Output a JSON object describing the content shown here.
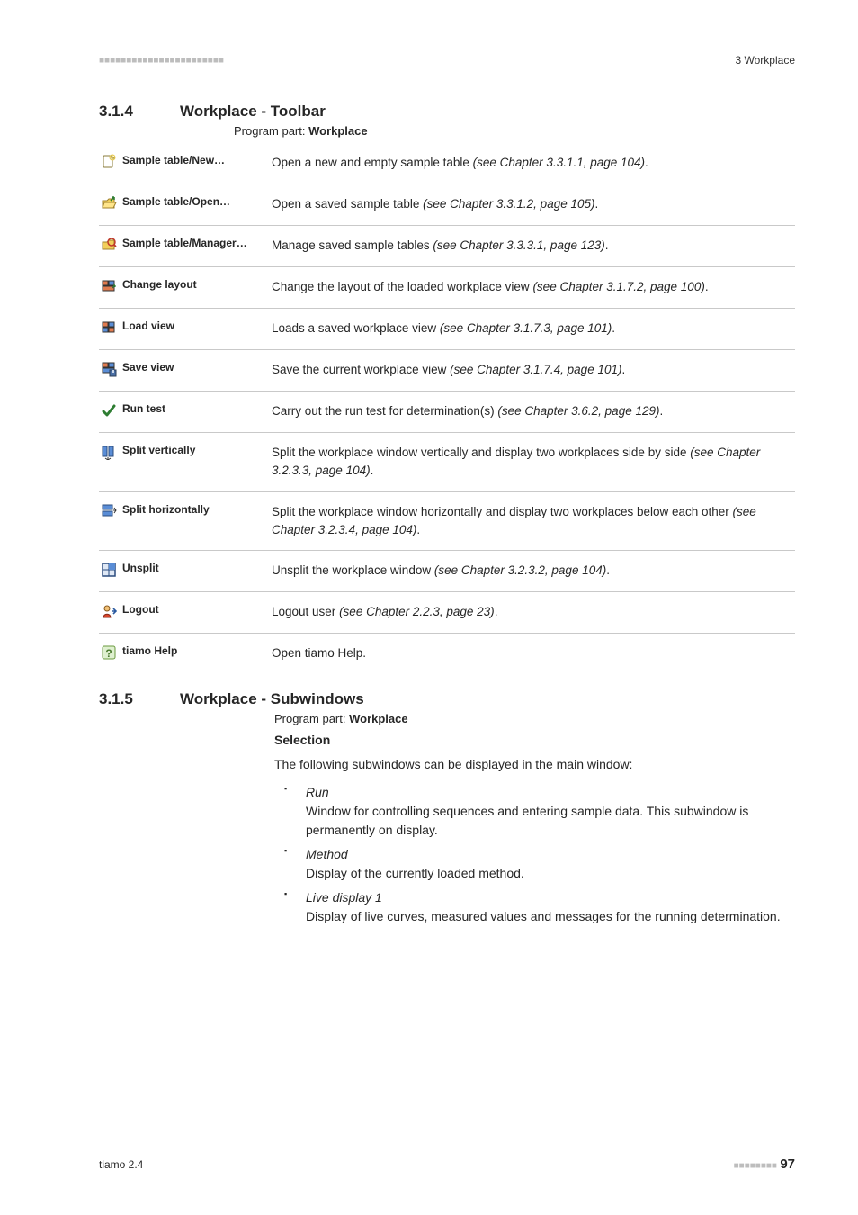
{
  "header": {
    "right": "3 Workplace"
  },
  "sec1": {
    "num": "3.1.4",
    "title": "Workplace - Toolbar",
    "program_prefix": "Program part: ",
    "program_part": "Workplace"
  },
  "toolbar": [
    {
      "icon": "new-icon",
      "label": "Sample table/New…",
      "desc": "Open a new and empty sample table ",
      "ref": "(see Chapter 3.3.1.1, page 104)",
      "suffix": "."
    },
    {
      "icon": "open-icon",
      "label": "Sample table/Open…",
      "desc": "Open a saved sample table ",
      "ref": "(see Chapter 3.3.1.2, page 105)",
      "suffix": "."
    },
    {
      "icon": "manager-icon",
      "label": "Sample table/Manager…",
      "desc": "Manage saved sample tables ",
      "ref": "(see Chapter 3.3.3.1, page 123)",
      "suffix": "."
    },
    {
      "icon": "change-layout-icon",
      "label": "Change layout",
      "desc": "Change the layout of the loaded workplace view ",
      "ref": "(see Chapter 3.1.7.2, page 100)",
      "suffix": "."
    },
    {
      "icon": "load-view-icon",
      "label": "Load view",
      "desc": "Loads a saved workplace view ",
      "ref": "(see Chapter 3.1.7.3, page 101)",
      "suffix": "."
    },
    {
      "icon": "save-view-icon",
      "label": "Save view",
      "desc": "Save the current workplace view ",
      "ref": "(see Chapter 3.1.7.4, page 101)",
      "suffix": "."
    },
    {
      "icon": "run-test-icon",
      "label": "Run test",
      "desc": "Carry out the run test for determination(s) ",
      "ref": "(see Chapter 3.6.2, page 129)",
      "suffix": "."
    },
    {
      "icon": "split-vertical-icon",
      "label": "Split vertically",
      "desc": "Split the workplace window vertically and display two workplaces side by side ",
      "ref": "(see Chapter 3.2.3.3, page 104)",
      "suffix": "."
    },
    {
      "icon": "split-horizontal-icon",
      "label": "Split horizontally",
      "desc": "Split the workplace window horizontally and display two workplaces below each other ",
      "ref": "(see Chapter 3.2.3.4, page 104)",
      "suffix": "."
    },
    {
      "icon": "unsplit-icon",
      "label": "Unsplit",
      "desc": "Unsplit the workplace window ",
      "ref": "(see Chapter 3.2.3.2, page 104)",
      "suffix": "."
    },
    {
      "icon": "logout-icon",
      "label": "Logout",
      "desc": "Logout user ",
      "ref": "(see Chapter 2.2.3, page 23)",
      "suffix": "."
    },
    {
      "icon": "help-icon",
      "label": "tiamo Help",
      "desc": "Open tiamo Help.",
      "ref": "",
      "suffix": ""
    }
  ],
  "sec2": {
    "num": "3.1.5",
    "title": "Workplace - Subwindows",
    "program_prefix": "Program part: ",
    "program_part": "Workplace",
    "selection_heading": "Selection",
    "intro": "The following subwindows can be displayed in the main window:",
    "items": [
      {
        "label": "Run",
        "desc": "Window for controlling sequences and entering sample data. This subwindow is permanently on display."
      },
      {
        "label": "Method",
        "desc": "Display of the currently loaded method."
      },
      {
        "label": "Live display 1",
        "desc": "Display of live curves, measured values and messages for the running determination."
      }
    ]
  },
  "footer": {
    "left": "tiamo 2.4",
    "page": "97"
  }
}
